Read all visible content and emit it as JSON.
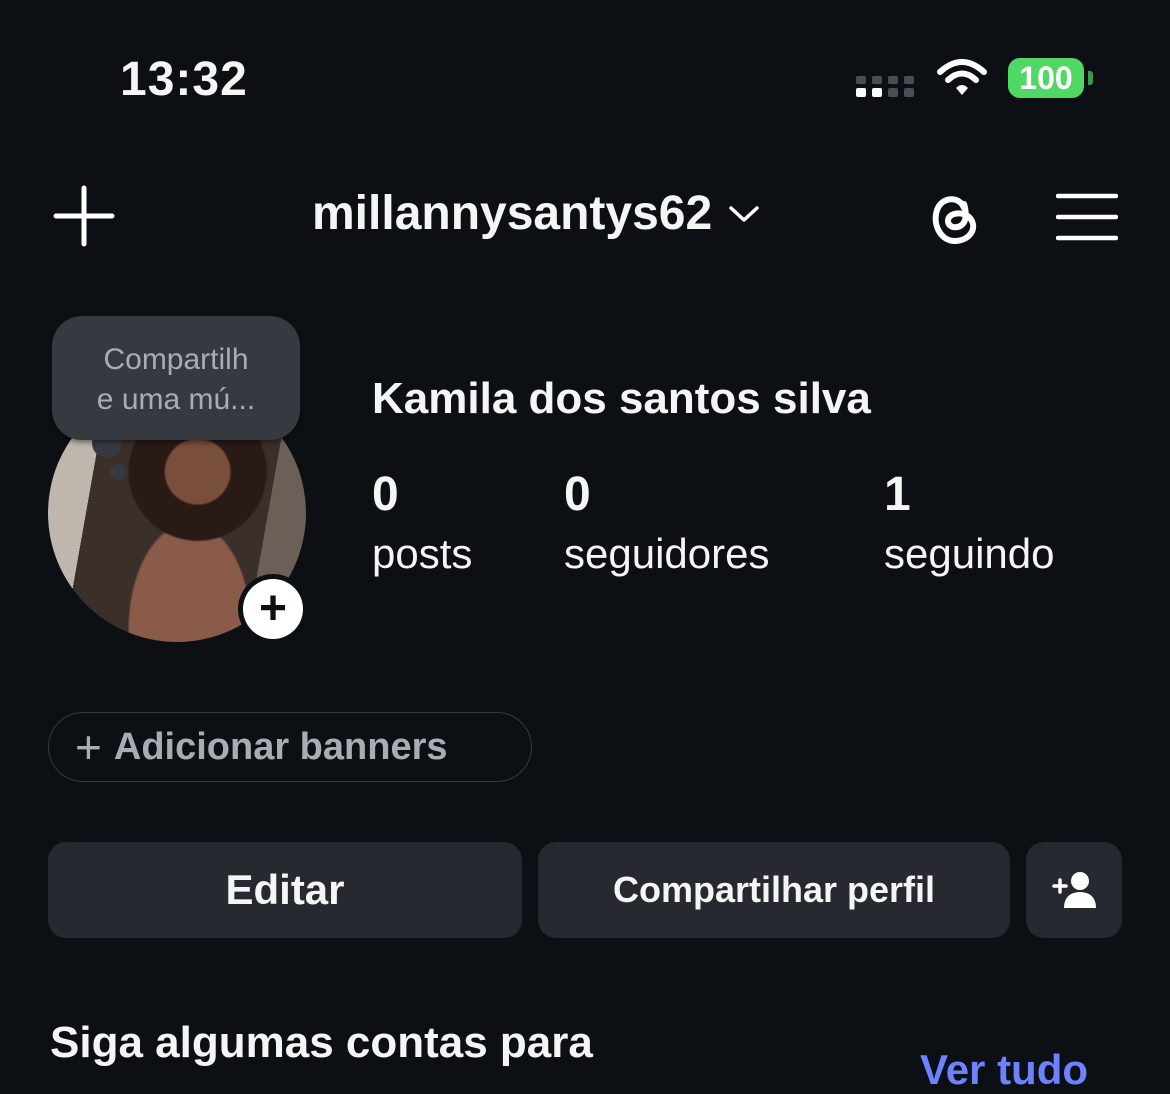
{
  "status_bar": {
    "time": "13:32",
    "battery": "100",
    "battery_color": "#4fd964",
    "signal_icon": "cellular-signal-icon",
    "wifi_icon": "wifi-icon"
  },
  "header": {
    "username": "millannysantys62",
    "create_icon": "plus-icon",
    "dropdown_icon": "chevron-down-icon",
    "threads_icon": "threads-icon",
    "menu_icon": "hamburger-menu-icon"
  },
  "note": {
    "text_line1": "Compartilh",
    "text_line2": "e uma mú..."
  },
  "profile": {
    "full_name": "Kamila dos santos silva",
    "stats": [
      {
        "value": "0",
        "label": "posts"
      },
      {
        "value": "0",
        "label": "seguidores"
      },
      {
        "value": "1",
        "label": "seguindo"
      }
    ]
  },
  "banners_pill": {
    "plus": "+",
    "label": "Adicionar banners"
  },
  "actions": {
    "edit_label": "Editar",
    "share_label": "Compartilhar perfil",
    "discover_icon": "add-person-icon"
  },
  "suggestions": {
    "title": "Siga algumas contas para",
    "see_all": "Ver tudo",
    "link_color": "#6e82ff"
  }
}
